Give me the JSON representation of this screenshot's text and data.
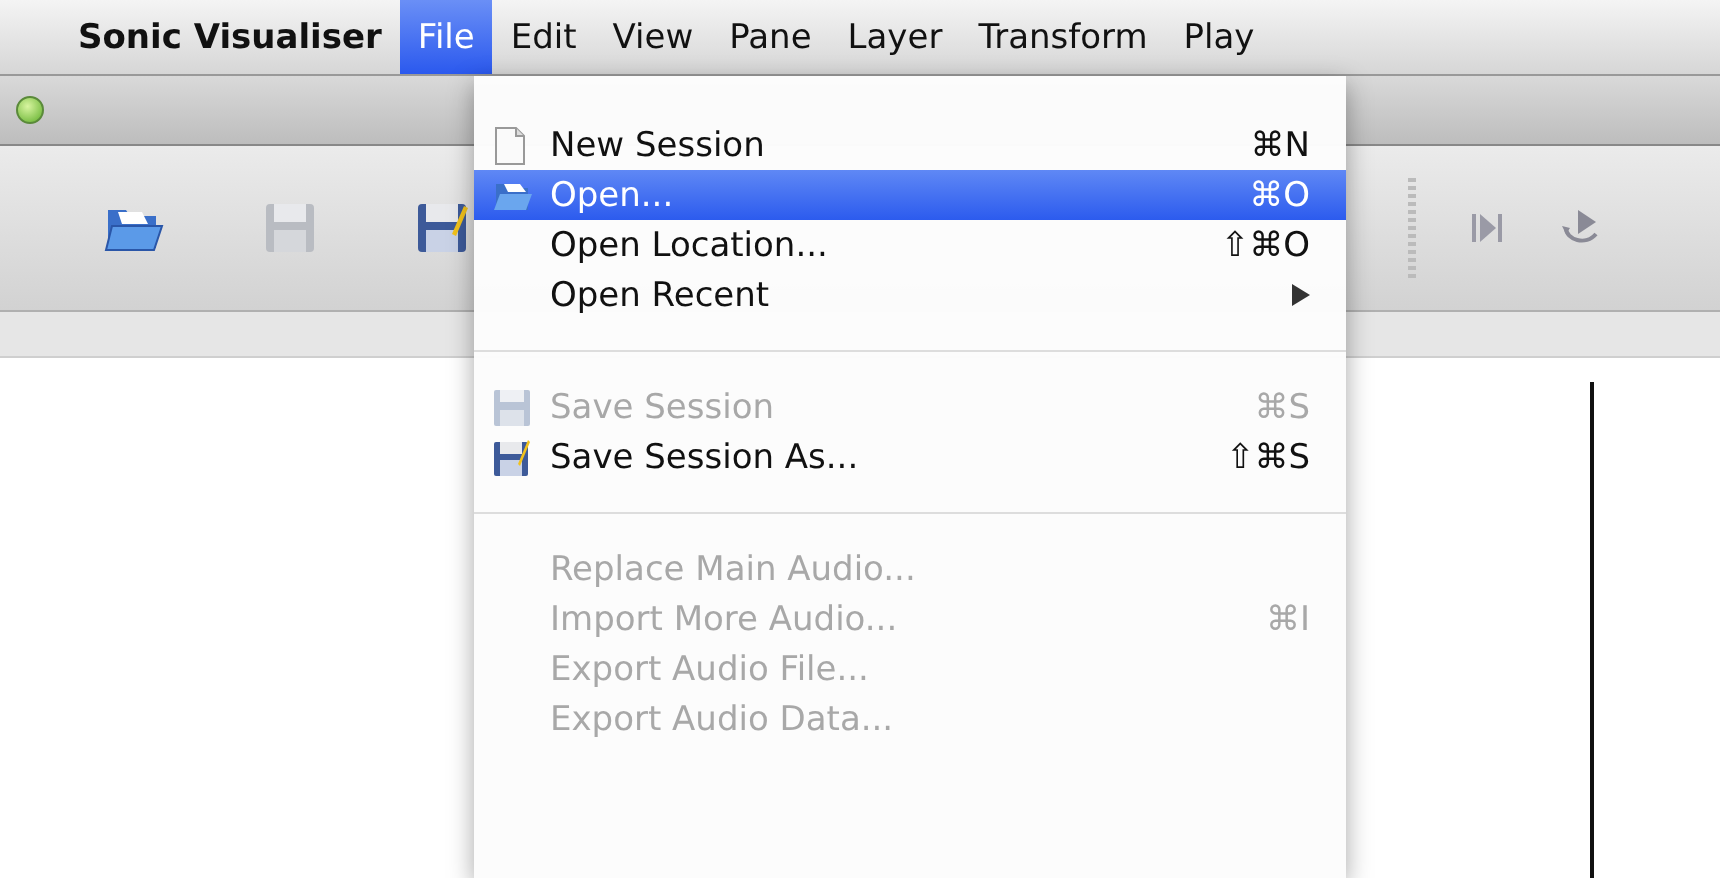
{
  "menu_bar": {
    "app_name": "Sonic Visualiser",
    "menus": [
      {
        "label": "File",
        "selected": true
      },
      {
        "label": "Edit",
        "selected": false
      },
      {
        "label": "View",
        "selected": false
      },
      {
        "label": "Pane",
        "selected": false
      },
      {
        "label": "Layer",
        "selected": false
      },
      {
        "label": "Transform",
        "selected": false
      },
      {
        "label": "Play",
        "selected": false
      }
    ]
  },
  "file_menu": {
    "items": [
      {
        "kind": "item",
        "label": "New Session",
        "shortcut": "⌘N",
        "disabled": false,
        "selected": false
      },
      {
        "kind": "item",
        "label": "Open...",
        "shortcut": "⌘O",
        "disabled": false,
        "selected": true
      },
      {
        "kind": "item",
        "label": "Open Location...",
        "shortcut": "⇧⌘O",
        "disabled": false,
        "selected": false
      },
      {
        "kind": "submenu",
        "label": "Open Recent",
        "disabled": false,
        "selected": false
      },
      {
        "kind": "separator"
      },
      {
        "kind": "item",
        "label": "Save Session",
        "shortcut": "⌘S",
        "disabled": true,
        "selected": false
      },
      {
        "kind": "item",
        "label": "Save Session As...",
        "shortcut": "⇧⌘S",
        "disabled": false,
        "selected": false
      },
      {
        "kind": "separator"
      },
      {
        "kind": "item",
        "label": "Replace Main Audio...",
        "disabled": true,
        "selected": false
      },
      {
        "kind": "item",
        "label": "Import More Audio...",
        "shortcut": "⌘I",
        "disabled": true,
        "selected": false
      },
      {
        "kind": "item",
        "label": "Export Audio File...",
        "disabled": true,
        "selected": false
      },
      {
        "kind": "item",
        "label": "Export Audio Data...",
        "disabled": true,
        "selected": false
      }
    ]
  }
}
